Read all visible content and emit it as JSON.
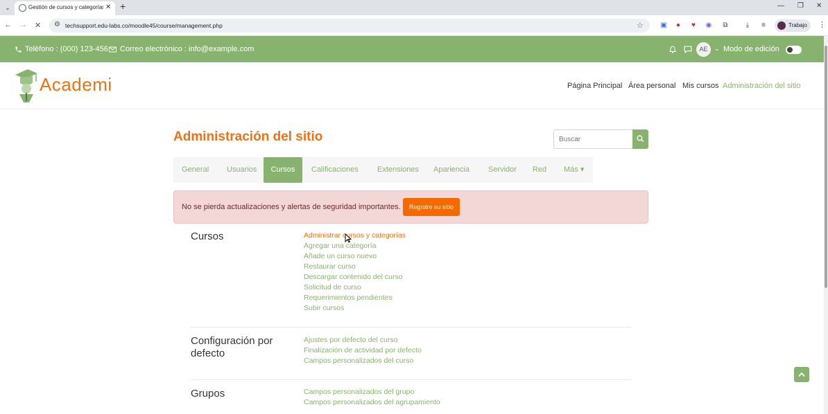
{
  "browser": {
    "tab_title": "Gestión de cursos y categorías |",
    "url": "techsupport.edu-labs.co/moodle45/course/management.php",
    "profile_name": "Trabajo"
  },
  "topbar": {
    "phone": "Teléfono : (000) 123-456",
    "email": "Correo electrónico : info@example.com",
    "avatar_initials": "AE",
    "edit_mode_label": "Modo de edición"
  },
  "header": {
    "logo_text": "Academi",
    "nav": [
      "Página Principal",
      "Área personal",
      "Mis cursos",
      "Administración del sitio"
    ]
  },
  "page": {
    "title": "Administración del sitio",
    "search_placeholder": "Buscar",
    "tabs": [
      "General",
      "Usuarios",
      "Cursos",
      "Calificaciones",
      "Extensiones",
      "Apariencia",
      "Servidor",
      "Red",
      "Más ▾"
    ],
    "active_tab": "Cursos",
    "alert_message": "No se pierda actualizaciones y alertas de seguridad importantes.",
    "alert_button": "Registre su sitio"
  },
  "sections": [
    {
      "title": "Cursos",
      "links": [
        "Administrar cursos y categorías",
        "Agregar una categoría",
        "Añade un curso nuevo",
        "Restaurar curso",
        "Descargar contenido del curso",
        "Solicitud de curso",
        "Requerimientos pendientes",
        "Subir cursos"
      ]
    },
    {
      "title": "Configuración por defecto",
      "links": [
        "Ajustes por defecto del curso",
        "Finalización de actividad por defecto",
        "Campos personalizados del curso"
      ]
    },
    {
      "title": "Grupos",
      "links": [
        "Campos personalizados del grupo",
        "Campos personalizados del agrupamiento"
      ]
    }
  ],
  "colors": {
    "brand_green": "#87b36e",
    "brand_orange": "#f07114",
    "alert_bg": "#f3d7d7",
    "button_orange": "#f56a00"
  }
}
